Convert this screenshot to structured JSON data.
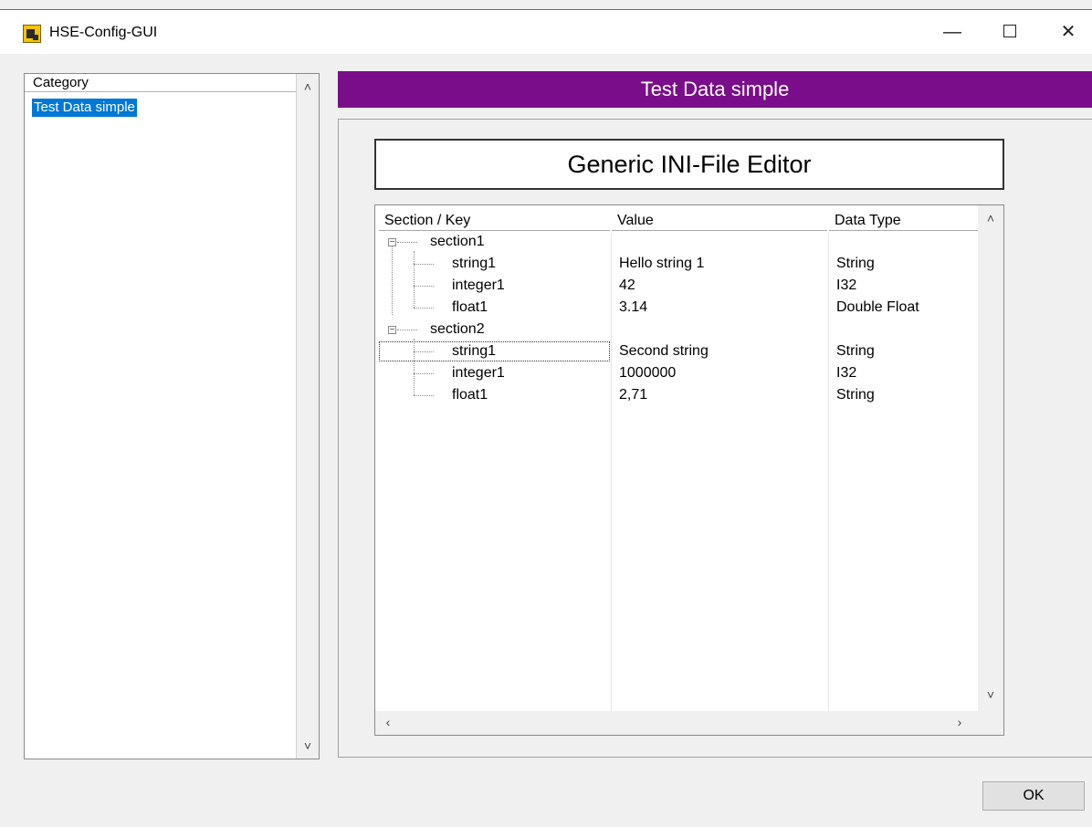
{
  "window": {
    "title": "HSE-Config-GUI",
    "controls": {
      "minimize": "—",
      "close": "✕"
    }
  },
  "category_list": {
    "header": "Category",
    "items": [
      {
        "label": "Test Data simple",
        "selected": true
      }
    ]
  },
  "page": {
    "header": "Test Data simple",
    "editor_title": "Generic INI-File Editor"
  },
  "tree": {
    "columns": [
      "Section / Key",
      "Value",
      "Data Type"
    ],
    "rows": [
      {
        "level": 0,
        "key": "section1",
        "value": "",
        "type": ""
      },
      {
        "level": 1,
        "key": "string1",
        "value": "Hello string 1",
        "type": "String"
      },
      {
        "level": 1,
        "key": "integer1",
        "value": "42",
        "type": "I32"
      },
      {
        "level": 1,
        "key": "float1",
        "value": "3.14",
        "type": "Double Float"
      },
      {
        "level": 0,
        "key": "section2",
        "value": "",
        "type": ""
      },
      {
        "level": 1,
        "key": "string1",
        "value": "Second string",
        "type": "String"
      },
      {
        "level": 1,
        "key": "integer1",
        "value": "1000000",
        "type": "I32"
      },
      {
        "level": 1,
        "key": "float1",
        "value": "2,71",
        "type": "String"
      }
    ],
    "focused_row": 5
  },
  "footer": {
    "ok_label": "OK"
  },
  "colors": {
    "header_bg": "#7a0d8a",
    "selection": "#0078d7"
  }
}
